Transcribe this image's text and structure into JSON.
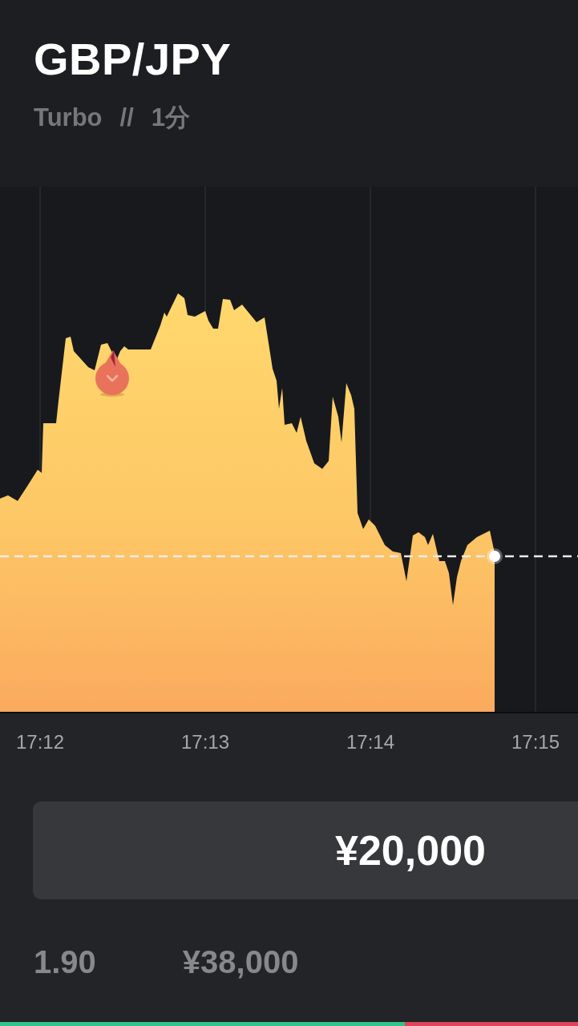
{
  "header": {
    "title": "GBP/JPY",
    "product": "Turbo",
    "separator": "//",
    "duration": "1分"
  },
  "chart": {
    "time_labels": [
      "17:12",
      "17:13",
      "17:14",
      "17:15"
    ]
  },
  "amount_field": {
    "value": "¥20,000"
  },
  "payout": {
    "multiplier": "1.90",
    "amount": "¥38,000"
  },
  "sentiment_bar": {
    "level": 0.7
  }
}
